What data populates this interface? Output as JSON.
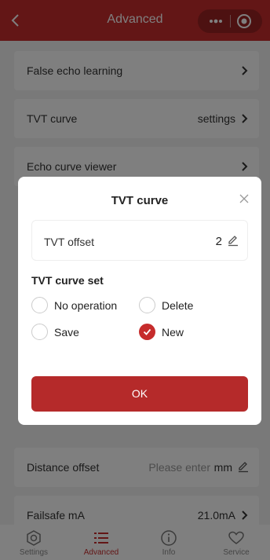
{
  "header": {
    "title": "Advanced"
  },
  "list": [
    {
      "label": "False echo learning",
      "value": ""
    },
    {
      "label": "TVT curve",
      "value": "settings"
    },
    {
      "label": "Echo curve viewer",
      "value": ""
    }
  ],
  "distance_offset": {
    "label": "Distance offset",
    "placeholder": "Please enter",
    "unit": "mm"
  },
  "failsafe": {
    "label": "Failsafe mA",
    "value": "21.0mA"
  },
  "tabs": [
    {
      "label": "Settings",
      "icon": "settings-icon",
      "active": false
    },
    {
      "label": "Advanced",
      "icon": "list-icon",
      "active": true
    },
    {
      "label": "Info",
      "icon": "info-icon",
      "active": false
    },
    {
      "label": "Service",
      "icon": "heart-icon",
      "active": false
    }
  ],
  "modal": {
    "title": "TVT curve",
    "offset_label": "TVT offset",
    "offset_value": "2",
    "set_title": "TVT curve set",
    "options": [
      {
        "label": "No operation",
        "checked": false
      },
      {
        "label": "Delete",
        "checked": false
      },
      {
        "label": "Save",
        "checked": false
      },
      {
        "label": "New",
        "checked": true
      }
    ],
    "ok_label": "OK"
  },
  "colors": {
    "accent": "#c62c2c",
    "overlay": "rgba(0,0,0,0.5)"
  }
}
